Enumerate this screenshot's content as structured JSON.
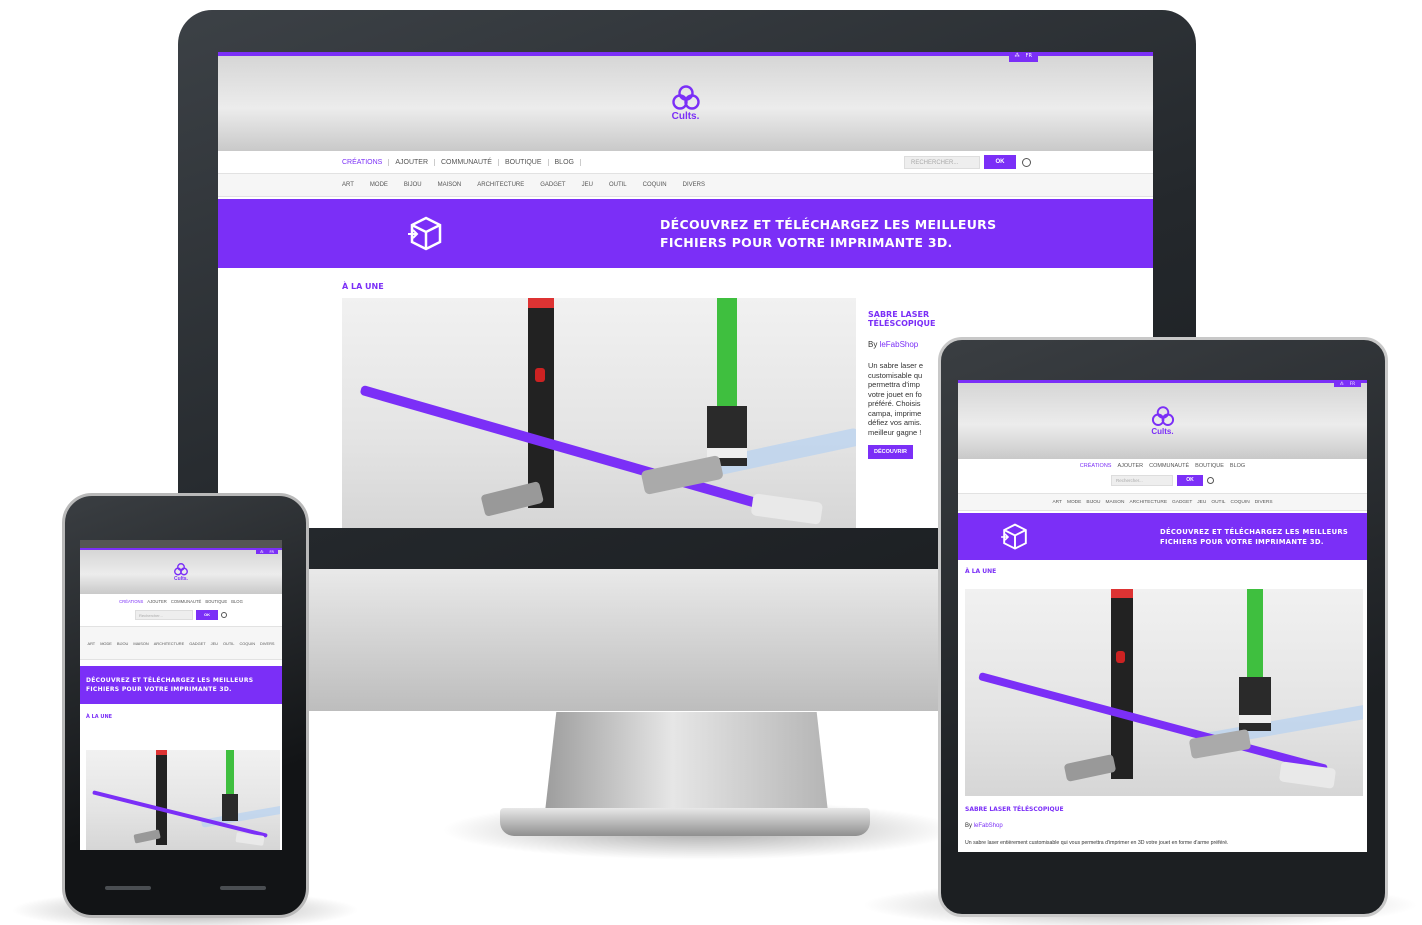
{
  "site": {
    "lang": {
      "left": "⁂",
      "right": "FR"
    },
    "logo_text": "Cults.",
    "nav": [
      "CRÉATIONS",
      "AJOUTER",
      "COMMUNAUTÉ",
      "BOUTIQUE",
      "BLOG"
    ],
    "search_placeholder": "Rechercher...",
    "ok_label": "OK",
    "categories": [
      "ART",
      "MODE",
      "BIJOU",
      "MAISON",
      "ARCHITECTURE",
      "GADGET",
      "JEU",
      "OUTIL",
      "COQUIN",
      "DIVERS"
    ],
    "banner_line1": "DÉCOUVREZ ET TÉLÉCHARGEZ LES MEILLEURS",
    "banner_line2": "FICHIERS POUR VOTRE IMPRIMANTE 3D.",
    "section_title": "À LA UNE",
    "featured": {
      "title_line1": "SABRE LASER",
      "title_line2": "TÉLÉSCOPIQUE",
      "title_full": "SABRE LASER TÉLÉSCOPIQUE",
      "by_prefix": "By ",
      "author": "leFabShop",
      "desc_desktop": [
        "Un sabre laser e",
        "customisable qu",
        "permettra d'imp",
        "votre jouet en fo",
        "préféré. Choisis",
        "campa, imprime",
        "défiez vos amis.",
        "meilleur gagne !"
      ],
      "desc_tablet": "Un sabre laser entièrement customisable qui vous permettra d'imprimer en 3D votre jouet en forme d'arme préféré.",
      "cta_label": "DÉCOUVRIR"
    }
  },
  "colors": {
    "brand": "#7b2ff7",
    "frame": "#24282c"
  }
}
